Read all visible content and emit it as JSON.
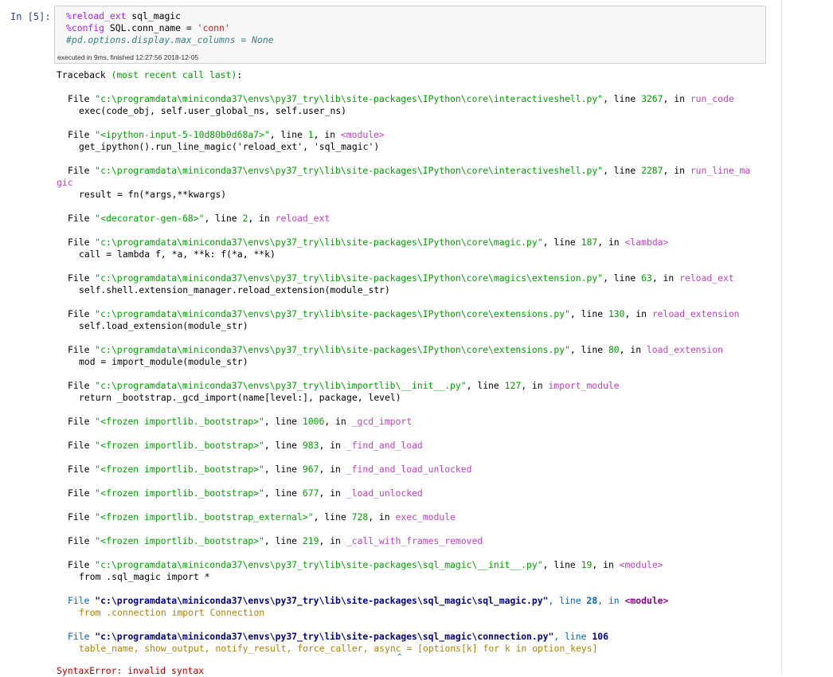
{
  "cell": {
    "prompt": "In [5]:",
    "code": {
      "line1_magic": "%reload_ext",
      "line1_rest": " sql_magic",
      "line2_magic": "%config",
      "line2_rest": " SQL.conn_name = ",
      "line2_str": "'conn'",
      "line3_comment": "#pd.options.display.max_columns = None"
    },
    "exec_info": "executed in 9ms, finished 12:27:56 2018-12-05"
  },
  "traceback": {
    "header_a": "Traceback ",
    "header_b": "(most recent call last)",
    "header_c": ":",
    "frames": [
      {
        "file": "\"c:\\programdata\\miniconda37\\envs\\py37_try\\lib\\site-packages\\IPython\\core\\interactiveshell.py\"",
        "line": "3267",
        "func": "run_code",
        "code": "exec(code_obj, self.user_global_ns, self.user_ns)"
      },
      {
        "file": "\"<ipython-input-5-10d80b0d68a7>\"",
        "line": "1",
        "func": "<module>",
        "code": "get_ipython().run_line_magic('reload_ext', 'sql_magic')"
      },
      {
        "file": "\"c:\\programdata\\miniconda37\\envs\\py37_try\\lib\\site-packages\\IPython\\core\\interactiveshell.py\"",
        "line": "2287",
        "func": "run_line_ma",
        "func_wrap": "gic",
        "code": "result = fn(*args,**kwargs)"
      },
      {
        "file": "\"<decorator-gen-68>\"",
        "line": "2",
        "func": "reload_ext",
        "code": ""
      },
      {
        "file": "\"c:\\programdata\\miniconda37\\envs\\py37_try\\lib\\site-packages\\IPython\\core\\magic.py\"",
        "line": "187",
        "func": "<lambda>",
        "code": "call = lambda f, *a, **k: f(*a, **k)"
      },
      {
        "file": "\"c:\\programdata\\miniconda37\\envs\\py37_try\\lib\\site-packages\\IPython\\core\\magics\\extension.py\"",
        "line": "63",
        "func": "reload_ext",
        "code": "self.shell.extension_manager.reload_extension(module_str)"
      },
      {
        "file": "\"c:\\programdata\\miniconda37\\envs\\py37_try\\lib\\site-packages\\IPython\\core\\extensions.py\"",
        "line": "130",
        "func": "reload_extension",
        "code": "self.load_extension(module_str)"
      },
      {
        "file": "\"c:\\programdata\\miniconda37\\envs\\py37_try\\lib\\site-packages\\IPython\\core\\extensions.py\"",
        "line": "80",
        "func": "load_extension",
        "code": "mod = import_module(module_str)"
      },
      {
        "file": "\"c:\\programdata\\miniconda37\\envs\\py37_try\\lib\\importlib\\__init__.py\"",
        "line": "127",
        "func": "import_module",
        "code": "return _bootstrap._gcd_import(name[level:], package, level)"
      },
      {
        "file": "\"<frozen importlib._bootstrap>\"",
        "line": "1006",
        "func": "_gcd_import",
        "code": ""
      },
      {
        "file": "\"<frozen importlib._bootstrap>\"",
        "line": "983",
        "func": "_find_and_load",
        "code": ""
      },
      {
        "file": "\"<frozen importlib._bootstrap>\"",
        "line": "967",
        "func": "_find_and_load_unlocked",
        "code": ""
      },
      {
        "file": "\"<frozen importlib._bootstrap>\"",
        "line": "677",
        "func": "_load_unlocked",
        "code": ""
      },
      {
        "file": "\"<frozen importlib._bootstrap_external>\"",
        "line": "728",
        "func": "exec_module",
        "code": ""
      },
      {
        "file": "\"<frozen importlib._bootstrap>\"",
        "line": "219",
        "func": "_call_with_frames_removed",
        "code": ""
      },
      {
        "file": "\"c:\\programdata\\miniconda37\\envs\\py37_try\\lib\\site-packages\\sql_magic\\__init__.py\"",
        "line": "19",
        "func": "<module>",
        "code": "from .sql_magic import *"
      }
    ],
    "last_frames": [
      {
        "file": "\"c:\\programdata\\miniconda37\\envs\\py37_try\\lib\\site-packages\\sql_magic\\sql_magic.py\"",
        "line": "28",
        "func": "<module>",
        "code": "from .connection import Connection"
      },
      {
        "file": "\"c:\\programdata\\miniconda37\\envs\\py37_try\\lib\\site-packages\\sql_magic\\connection.py\"",
        "line": "106",
        "code": "table_name, show_output, notify_result, force_caller, async = [options[k] for k in option_keys]"
      }
    ],
    "caret": "^",
    "error": "SyntaxError: invalid syntax"
  },
  "labels": {
    "file_kw": "File ",
    "line_kw": ", line ",
    "in_kw": ", in "
  }
}
